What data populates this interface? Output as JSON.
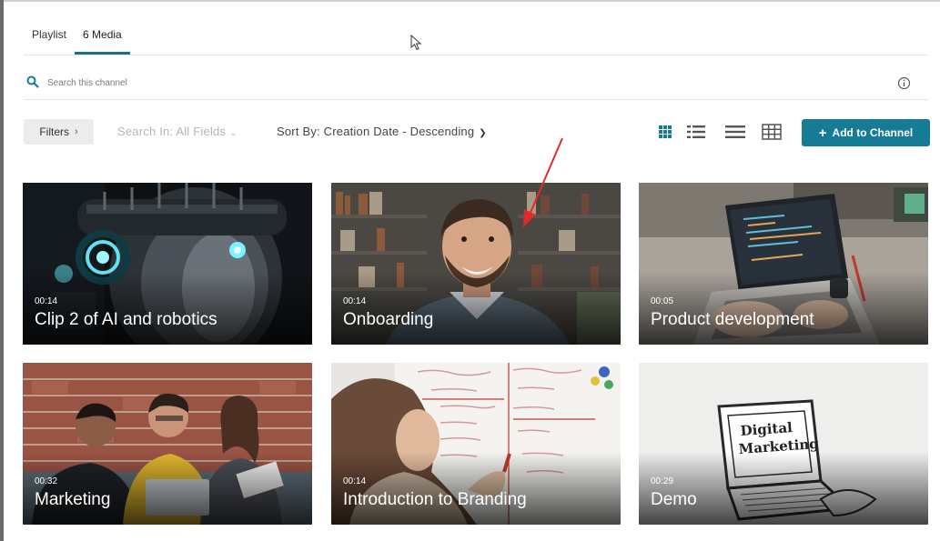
{
  "tabs": [
    {
      "label": "Playlist",
      "active": false
    },
    {
      "label": "6 Media",
      "active": true
    }
  ],
  "search": {
    "placeholder": "Search this channel"
  },
  "toolbar": {
    "filters_label": "Filters",
    "search_in_label": "Search In: All Fields",
    "sort_by_label": "Sort By: Creation Date - Descending",
    "add_label": "Add to Channel",
    "views": [
      "grid-view-icon",
      "detailed-list-icon",
      "compact-list-icon",
      "table-view-icon"
    ]
  },
  "colors": {
    "accent": "#167b94",
    "tab_underline": "#1b6e8c",
    "annotation_arrow": "#e02b2b"
  },
  "media": [
    {
      "duration": "00:14",
      "title": "Clip 2 of AI and robotics"
    },
    {
      "duration": "00:14",
      "title": "Onboarding"
    },
    {
      "duration": "00:05",
      "title": "Product development"
    },
    {
      "duration": "00:32",
      "title": "Marketing"
    },
    {
      "duration": "00:14",
      "title": "Introduction to Branding"
    },
    {
      "duration": "00:29",
      "title": "Demo"
    }
  ],
  "thumbnails": {
    "demo_sketch_text": [
      "Digital",
      "Marketing"
    ]
  }
}
